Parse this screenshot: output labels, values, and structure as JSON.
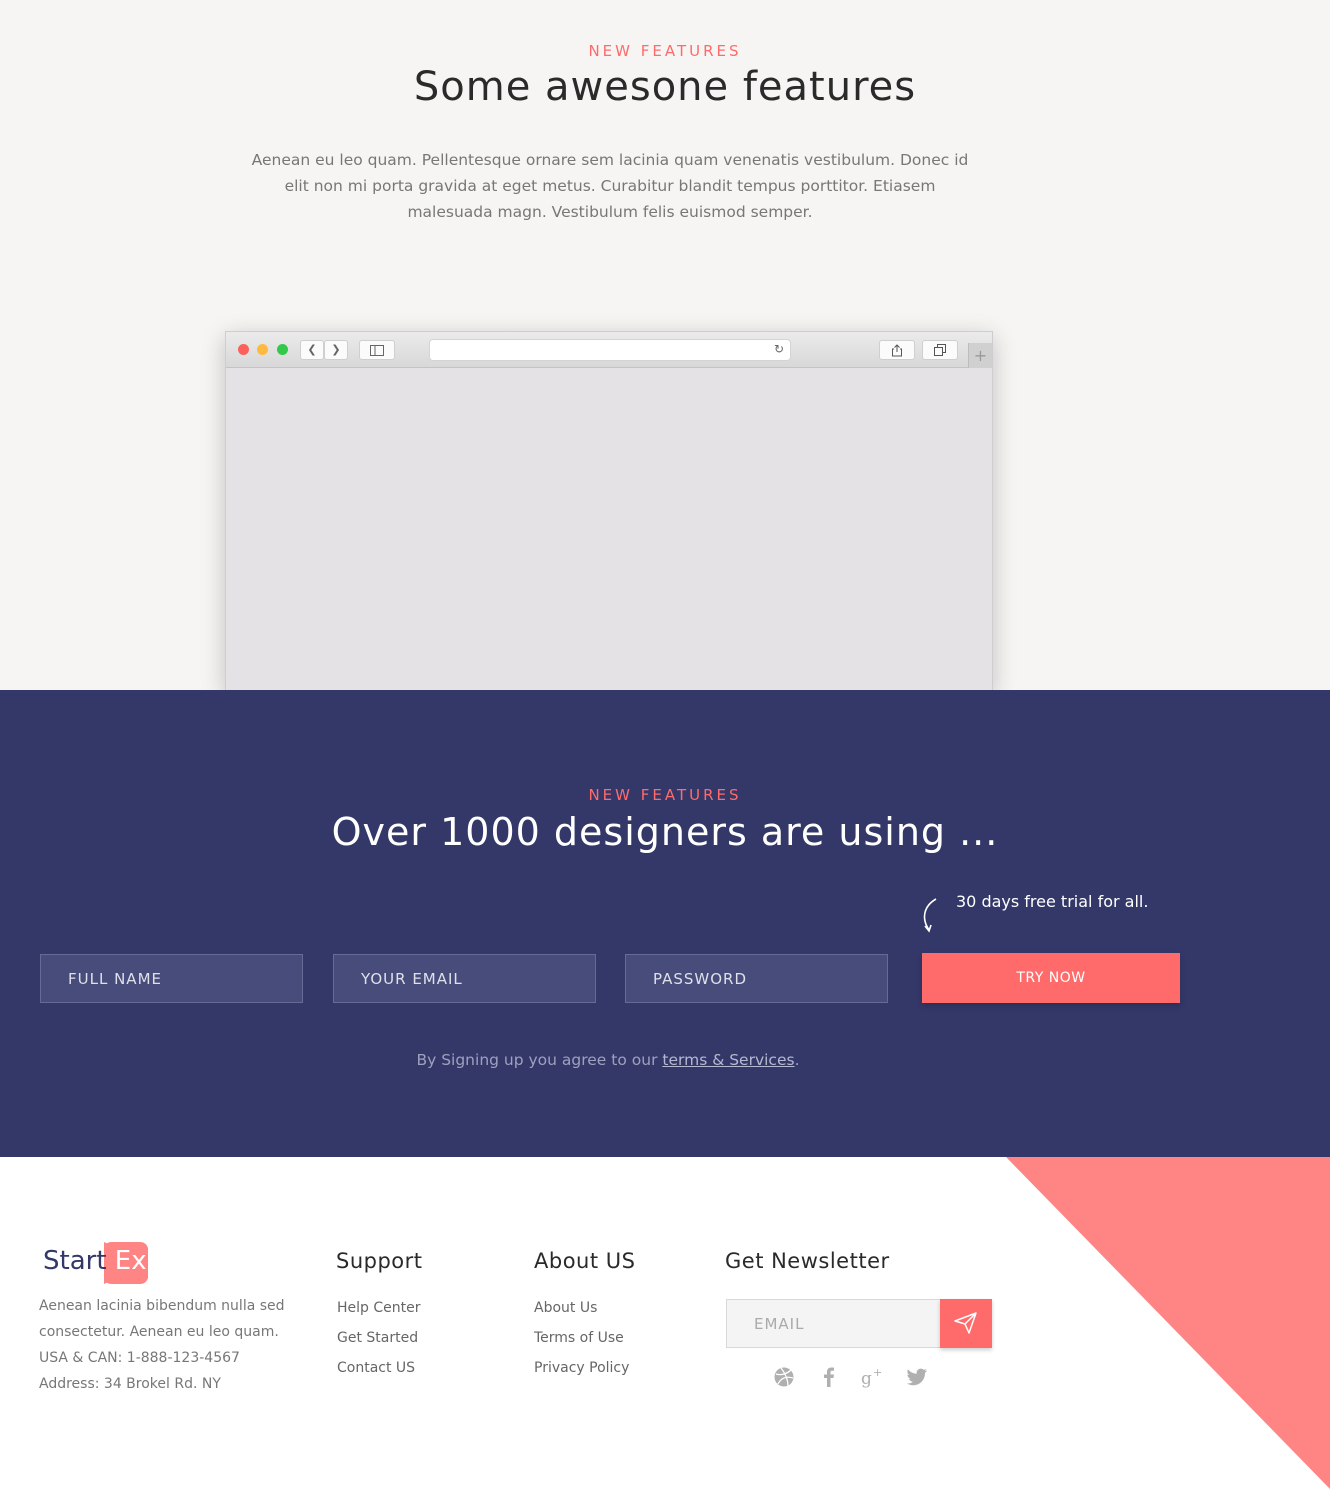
{
  "features": {
    "eyebrow": "NEW FEATURES",
    "title": "Some awesone features",
    "description": "Aenean eu leo quam. Pellentesque ornare sem lacinia quam venenatis vestibulum. Donec id elit non mi porta gravida at eget metus. Curabitur blandit tempus porttitor. Etiasem malesuada magn. Vestibulum felis euismod semper."
  },
  "signup": {
    "eyebrow": "NEW FEATURES",
    "title": "Over 1000 designers are using ...",
    "trial_note": "30 days free trial for all.",
    "fields": {
      "full_name_placeholder": "FULL NAME",
      "email_placeholder": "YOUR EMAIL",
      "password_placeholder": "PASSWORD"
    },
    "button_label": "TRY NOW",
    "terms_prefix": "By Signing up you agree to our ",
    "terms_link": "terms & Services",
    "terms_suffix": "."
  },
  "footer": {
    "logo": {
      "part1": "Start",
      "part2": "Ex"
    },
    "about_lines": [
      "Aenean lacinia bibendum nulla sed",
      "consectetur. Aenean eu leo quam.",
      "USA &  CAN: 1-888-123-4567",
      "Address: 34 Brokel Rd. NY"
    ],
    "support": {
      "title": "Support",
      "links": [
        "Help Center",
        "Get Started",
        "Contact US"
      ]
    },
    "about_us": {
      "title": "About US",
      "links": [
        "About Us",
        "Terms of Use",
        "Privacy Policy"
      ]
    },
    "newsletter": {
      "title": "Get Newsletter",
      "placeholder": "EMAIL"
    },
    "social_icons": [
      "dribbble-icon",
      "facebook-icon",
      "google-plus-icon",
      "twitter-icon"
    ]
  },
  "colors": {
    "accent": "#ff6b6b",
    "navy": "#343869",
    "light_bg": "#f6f5f3",
    "triangle": "#ff8585"
  }
}
